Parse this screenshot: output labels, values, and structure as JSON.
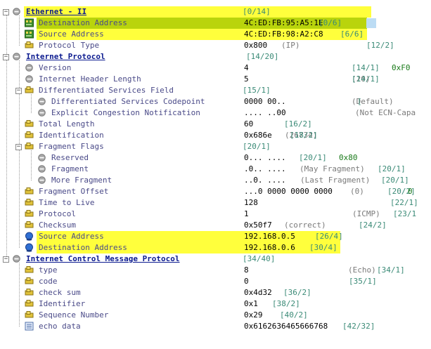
{
  "colors": {
    "highlight_yellow": "#ffff3c",
    "highlight_green": "#b9d40c",
    "field_name": "#4a4a88",
    "protocol_name": "#0b1a8f",
    "position": "#3a8a76",
    "note": "#7a7a7a",
    "hex_value": "#1a7a1a"
  },
  "rows": [
    {
      "name": "Ethernet - II",
      "value": "",
      "note": "",
      "pos": "[0/14]",
      "icon": "collapse-box",
      "highlight": "yellow",
      "protocol": true
    },
    {
      "name": "Destination Address",
      "value": "4C:ED:FB:95:A5:1E",
      "note": "",
      "pos": "[0/6]",
      "icon": "mac-address-icon",
      "highlight": "green"
    },
    {
      "name": "Source Address",
      "value": "4C:ED:FB:98:A2:C8",
      "note": "",
      "pos": "[6/6]",
      "icon": "mac-address-icon",
      "highlight": "yellow"
    },
    {
      "name": "Protocol Type",
      "value": "0x800",
      "note": "(IP)",
      "pos": "[12/2]",
      "icon": "field-icon"
    },
    {
      "name": "Internet Protocol",
      "value": "",
      "note": "",
      "pos": "[14/20]",
      "icon": "collapse-box",
      "protocol": true
    },
    {
      "name": "Version",
      "value": "4",
      "note": "",
      "pos": "[14/1]",
      "hex": "0xF0",
      "icon": "gray-dot-icon"
    },
    {
      "name": "Internet Header Length",
      "value": "5",
      "note": "(20)",
      "pos": "[14/1]",
      "icon": "gray-dot-icon"
    },
    {
      "name": "Differentiated Services Field",
      "value": "",
      "note": "",
      "pos": "[15/1]",
      "icon": "collapse-box"
    },
    {
      "name": "Differentiated Services Codepoint",
      "value": "0000 00..",
      "note": "(Default)",
      "pos": "[",
      "icon": "gray-dot-icon"
    },
    {
      "name": "Explicit Congestion Notification",
      "value": ".... ..00",
      "note": "(Not ECN-Capa",
      "pos": "",
      "icon": "gray-dot-icon"
    },
    {
      "name": "Total Length",
      "value": "60",
      "note": "",
      "pos": "[16/2]",
      "icon": "field-icon"
    },
    {
      "name": "Identification",
      "value": "0x686e",
      "note": "(26734)",
      "pos": "[18/2]",
      "icon": "field-icon"
    },
    {
      "name": "Fragment Flags",
      "value": "",
      "note": "",
      "pos": "[20/1]",
      "icon": "collapse-box"
    },
    {
      "name": "Reserved",
      "value": "0... ....",
      "note": "",
      "pos": "[20/1]",
      "hex": "0x80",
      "icon": "gray-dot-icon"
    },
    {
      "name": "Fragment",
      "value": ".0.. ....",
      "note": "(May Fragment)",
      "pos": "[20/1]",
      "icon": "gray-dot-icon"
    },
    {
      "name": "More Fragment",
      "value": "..0. ....",
      "note": "(Last Fragment)",
      "pos": "[20/1]",
      "icon": "gray-dot-icon"
    },
    {
      "name": "Fragment Offset",
      "value": "...0 0000 0000 0000",
      "note": "(0)",
      "pos": "[20/2]",
      "hex": "0",
      "icon": "field-icon"
    },
    {
      "name": "Time to Live",
      "value": "128",
      "note": "",
      "pos": "[22/1]",
      "icon": "field-icon"
    },
    {
      "name": "Protocol",
      "value": "1",
      "note": "(ICMP)",
      "pos": "[23/1",
      "icon": "field-icon"
    },
    {
      "name": "Checksum",
      "value": "0x50f7",
      "note": "(correct)",
      "pos": "[24/2]",
      "icon": "field-icon"
    },
    {
      "name": "Source Address",
      "value": "192.168.0.5",
      "note": "",
      "pos": "[26/4]",
      "icon": "ip-address-icon",
      "highlight": "yellow"
    },
    {
      "name": "Destination Address",
      "value": "192.168.0.6",
      "note": "",
      "pos": "[30/4]",
      "icon": "ip-address-icon",
      "highlight": "yellow"
    },
    {
      "name": "Internet Control Message Protocol",
      "value": "",
      "note": "",
      "pos": "[34/40]",
      "icon": "collapse-box",
      "protocol": true
    },
    {
      "name": "type",
      "value": "8",
      "note": "(Echo)",
      "pos": "[34/1]",
      "icon": "field-icon"
    },
    {
      "name": "code",
      "value": "0",
      "note": "",
      "pos": "[35/1]",
      "icon": "field-icon"
    },
    {
      "name": "check sum",
      "value": "0x4d32",
      "note": "",
      "pos": "[36/2]",
      "icon": "field-icon"
    },
    {
      "name": "Identifier",
      "value": "0x1",
      "note": "",
      "pos": "[38/2]",
      "icon": "field-icon"
    },
    {
      "name": "Sequence Number",
      "value": "0x29",
      "note": "",
      "pos": "[40/2]",
      "icon": "field-icon"
    },
    {
      "name": "echo data",
      "value": "0x6162636465666768",
      "note": "",
      "pos": "[42/32]",
      "icon": "data-icon"
    }
  ]
}
